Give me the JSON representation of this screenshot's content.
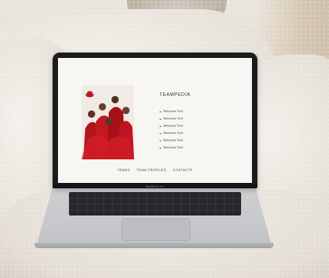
{
  "laptop": {
    "brand": "MacBook Pro"
  },
  "website": {
    "title": "TEAMPEDIA",
    "menu_items": [
      "Welcome Text",
      "Welcome Text",
      "Welcome Text",
      "Welcome Text",
      "Welcome Text",
      "Welcome Text"
    ],
    "footer_links": [
      "TEAMS",
      "TEAM PROFILES",
      "CONTACTS"
    ]
  }
}
